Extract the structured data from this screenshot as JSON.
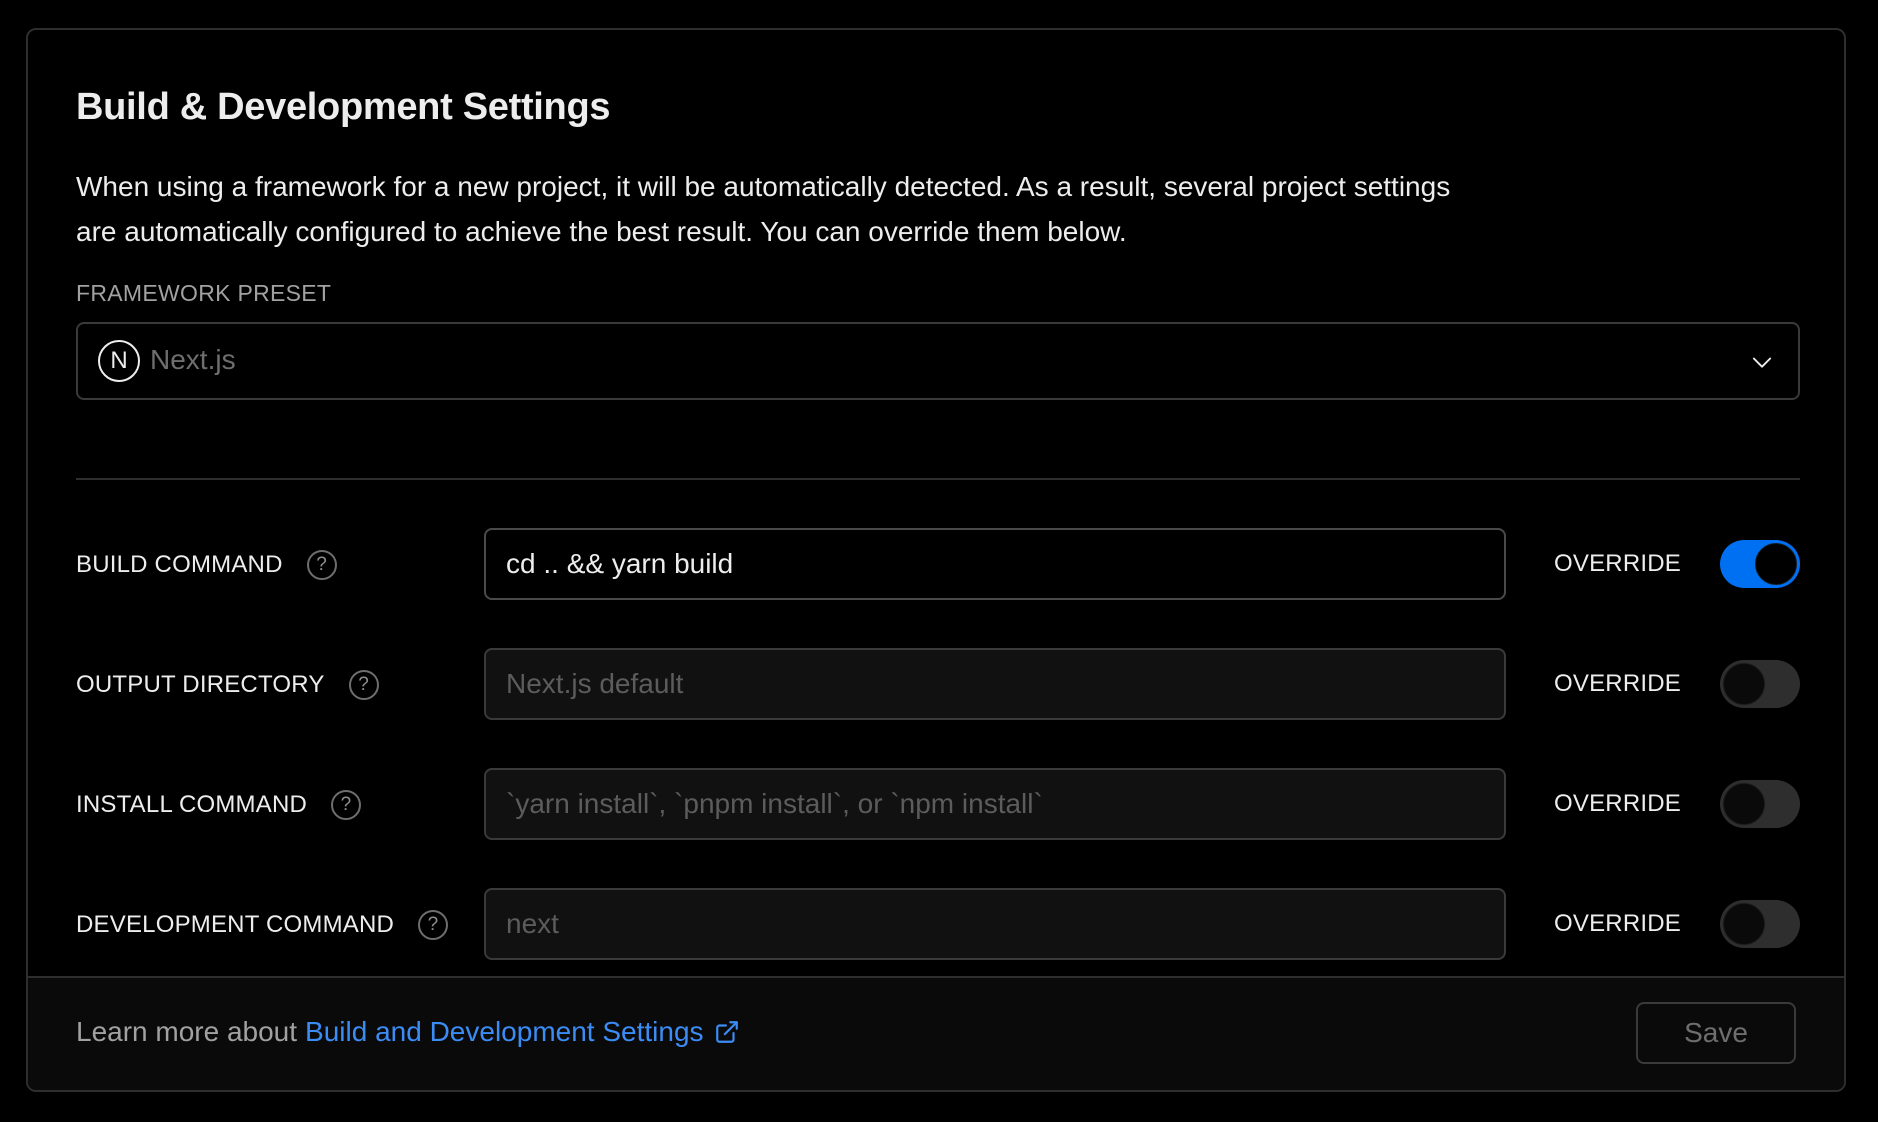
{
  "section": {
    "title": "Build & Development Settings",
    "description": "When using a framework for a new project, it will be automatically detected. As a result, several project settings are automatically configured to achieve the best result. You can override them below."
  },
  "framework": {
    "label": "FRAMEWORK PRESET",
    "logo_letter": "N",
    "selected": "Next.js",
    "icon": "chevron-down-icon"
  },
  "rows": [
    {
      "label": "BUILD COMMAND",
      "value": "cd .. && yarn build",
      "placeholder": "",
      "override_label": "OVERRIDE",
      "override": true
    },
    {
      "label": "OUTPUT DIRECTORY",
      "value": "",
      "placeholder": "Next.js default",
      "override_label": "OVERRIDE",
      "override": false
    },
    {
      "label": "INSTALL COMMAND",
      "value": "",
      "placeholder": "`yarn install`, `pnpm install`, or `npm install`",
      "override_label": "OVERRIDE",
      "override": false
    },
    {
      "label": "DEVELOPMENT COMMAND",
      "value": "",
      "placeholder": "next",
      "override_label": "OVERRIDE",
      "override": false
    }
  ],
  "help_glyph": "?",
  "footer": {
    "learn_prefix": "Learn more about",
    "learn_link": "Build and Development Settings",
    "save_label": "Save"
  },
  "colors": {
    "accent": "#0070f3",
    "link": "#3b8cf5",
    "background": "#000000"
  }
}
